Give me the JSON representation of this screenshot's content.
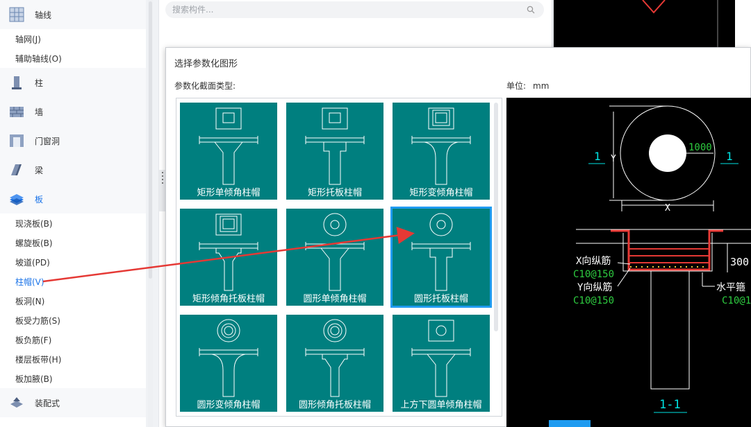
{
  "sidebar": {
    "categories": [
      {
        "label": "轴线",
        "icon": "grid-icon",
        "active": false
      },
      {
        "label": "柱",
        "icon": "column-icon",
        "active": false
      },
      {
        "label": "墙",
        "icon": "wall-icon",
        "active": false
      },
      {
        "label": "门窗洞",
        "icon": "door-window-icon",
        "active": false
      },
      {
        "label": "梁",
        "icon": "beam-icon",
        "active": false
      },
      {
        "label": "板",
        "icon": "slab-icon",
        "active": true
      },
      {
        "label": "装配式",
        "icon": "prefab-icon",
        "active": false
      }
    ],
    "axis_items": [
      "轴网(J)",
      "辅助轴线(O)"
    ],
    "slab_items": [
      "现浇板(B)",
      "螺旋板(B)",
      "坡道(PD)",
      "柱帽(V)",
      "板洞(N)",
      "板受力筋(S)",
      "板负筋(F)",
      "楼层板带(H)",
      "板加腋(B)"
    ],
    "selected_item": "柱帽(V)"
  },
  "search": {
    "placeholder": "搜索构件..."
  },
  "dialog": {
    "title": "选择参数化图形",
    "type_label": "参数化截面类型:",
    "unit_label": "单位:",
    "unit_value": "mm",
    "shapes": [
      {
        "label": "矩形单倾角柱帽",
        "plan": "square",
        "profile": "cone"
      },
      {
        "label": "矩形托板柱帽",
        "plan": "square",
        "profile": "plate"
      },
      {
        "label": "矩形变倾角柱帽",
        "plan": "square-double",
        "profile": "curve"
      },
      {
        "label": "矩形倾角托板柱帽",
        "plan": "square-double",
        "profile": "cone-plate"
      },
      {
        "label": "圆形单倾角柱帽",
        "plan": "circle",
        "profile": "cone"
      },
      {
        "label": "圆形托板柱帽",
        "plan": "circle",
        "profile": "plate"
      },
      {
        "label": "圆形变倾角柱帽",
        "plan": "circle-double",
        "profile": "curve"
      },
      {
        "label": "圆形倾角托板柱帽",
        "plan": "circle-double",
        "profile": "cone-plate"
      },
      {
        "label": "上方下圆单倾角柱帽",
        "plan": "square-circle",
        "profile": "cone"
      }
    ],
    "selected_index": 5,
    "preview": {
      "diameter": "1000",
      "section_mark": "1",
      "dim_y": "Y",
      "dim_x": "X",
      "height": "300",
      "x_rebar_label": "X向纵筋",
      "x_rebar_spec": "C10@150",
      "y_rebar_label": "Y向纵筋",
      "y_rebar_spec": "C10@150",
      "h_rebar_label": "水平箍",
      "h_rebar_spec": "C10@1",
      "section_title": "1-1"
    }
  },
  "colors": {
    "tile": "#007f7f",
    "accent": "#1a73e8",
    "selection": "#1f9bf0",
    "annotation": "#e53935"
  }
}
